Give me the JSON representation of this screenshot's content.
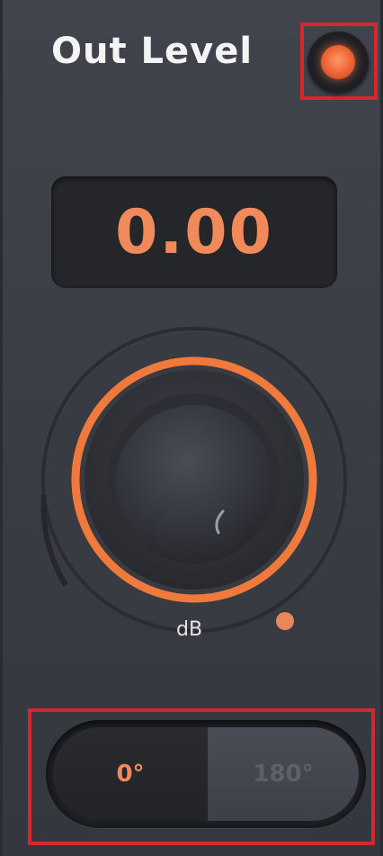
{
  "module": {
    "title": "Out Level"
  },
  "power": {
    "state": "on",
    "icon": "power-led-icon",
    "color": "#f26a3a"
  },
  "readout": {
    "value": "0.00"
  },
  "knob": {
    "unit_label": "dB",
    "value_fraction": 0.5,
    "accent_color": "#f07a3c"
  },
  "phase": {
    "options": [
      "0°",
      "180°"
    ],
    "selected": "0°",
    "active_color": "#f08a5a",
    "inactive_color": "#5d6068"
  }
}
